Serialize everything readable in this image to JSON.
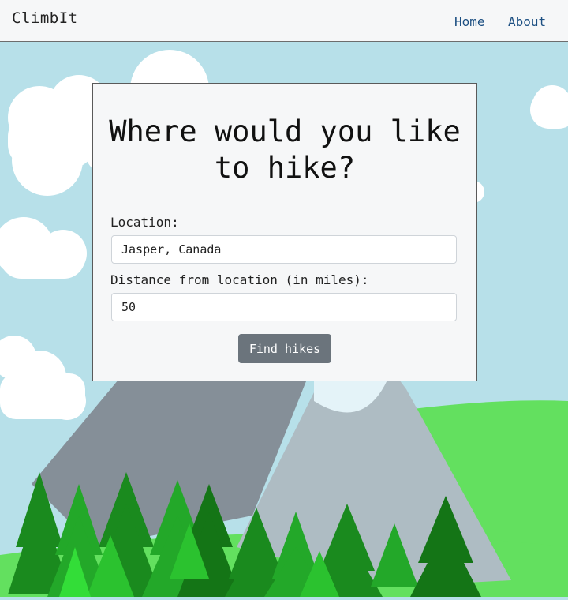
{
  "navbar": {
    "brand": "ClimbIt",
    "links": [
      {
        "label": "Home"
      },
      {
        "label": "About"
      }
    ]
  },
  "search_card": {
    "title": "Where would you like to hike?",
    "location": {
      "label": "Location:",
      "value": "Jasper, Canada"
    },
    "distance": {
      "label": "Distance from location (in miles):",
      "value": "50"
    },
    "submit_label": "Find hikes"
  },
  "colors": {
    "sky": "#b7e0e9",
    "cloud": "#ffffff",
    "mountain_dark": "#858f98",
    "mountain_light": "#aebcc3",
    "snow": "#e4f3f8",
    "grass": "#63e05f",
    "button": "#6b747c",
    "nav_link": "#1c4f82"
  }
}
